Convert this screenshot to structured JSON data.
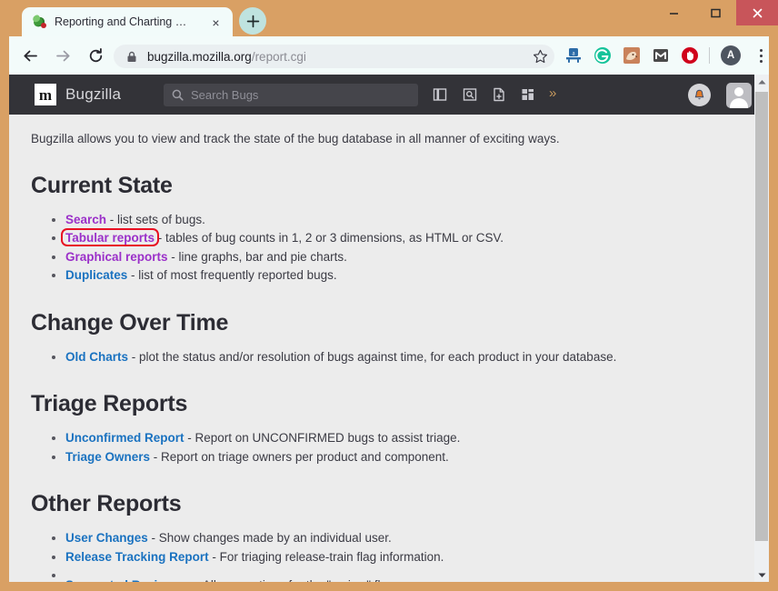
{
  "window": {
    "minimize_label": "Minimize",
    "maximize_label": "Maximize",
    "close_label": "Close",
    "accent_color": "#d9a064",
    "close_button_color": "#c8555a"
  },
  "browser": {
    "tab": {
      "title": "Reporting and Charting Kitchen",
      "favicon": "bugzilla-bug-favicon",
      "close_label": "×"
    },
    "new_tab_label": "+",
    "nav": {
      "back": "back-arrow",
      "forward": "forward-arrow",
      "reload": "reload-arrow"
    },
    "url": {
      "lock": "lock-icon",
      "domain": "bugzilla.mozilla.org",
      "path": "/report.cgi"
    },
    "bookmark_label": "star-outline",
    "extensions": [
      {
        "name": "amazon-assistant-icon",
        "letter": "a",
        "color": "#3a6ea5"
      },
      {
        "name": "grammarly-icon",
        "letter": "G",
        "color": "#15c39a"
      },
      {
        "name": "dog-extension-icon",
        "letter": "",
        "color": "#c9825b"
      },
      {
        "name": "gmail-checker-icon",
        "letter": "M",
        "color": "#4a4a4a"
      },
      {
        "name": "adblock-icon",
        "letter": "",
        "color": "#d0021b"
      }
    ],
    "profile_initial": "A",
    "menu_label": "chrome-menu"
  },
  "bugzilla": {
    "logo_letter": "m",
    "site_title": "Bugzilla",
    "search": {
      "placeholder": "Search Bugs",
      "value": ""
    },
    "nav_icons": [
      "browse-columns-icon",
      "search-bugs-icon",
      "new-bug-icon",
      "dashboard-grid-icon"
    ],
    "more_label": "»",
    "bell_label": "notifications-bell",
    "avatar_label": "user-avatar"
  },
  "page": {
    "intro": "Bugzilla allows you to view and track the state of the bug database in all manner of exciting ways.",
    "sections": [
      {
        "heading": "Current State",
        "items": [
          {
            "link": "Search",
            "color": "violet",
            "desc": " - list sets of bugs."
          },
          {
            "link": "Tabular reports",
            "color": "violet",
            "desc": " - tables of bug counts in 1, 2 or 3 dimensions, as HTML or CSV."
          },
          {
            "link": "Graphical reports",
            "color": "violet",
            "desc": " - line graphs, bar and pie charts."
          },
          {
            "link": "Duplicates",
            "color": "blue",
            "desc": " - list of most frequently reported bugs."
          }
        ]
      },
      {
        "heading": "Change Over Time",
        "items": [
          {
            "link": "Old Charts",
            "color": "blue",
            "desc": " - plot the status and/or resolution of bugs against time, for each product in your database."
          }
        ]
      },
      {
        "heading": "Triage Reports",
        "items": [
          {
            "link": "Unconfirmed Report",
            "color": "blue",
            "desc": " - Report on UNCONFIRMED bugs to assist triage."
          },
          {
            "link": "Triage Owners",
            "color": "blue",
            "desc": " - Report on triage owners per product and component."
          }
        ]
      },
      {
        "heading": "Other Reports",
        "items": [
          {
            "link": "User Changes",
            "color": "blue",
            "desc": " - Show changes made by an individual user."
          },
          {
            "link": "Release Tracking Report",
            "color": "blue",
            "desc": " - For triaging release-train flag information."
          },
          {
            "link": "Suggested Reviewers",
            "color": "blue",
            "desc": " - All suggestions for the \"review\" flag."
          }
        ]
      }
    ]
  },
  "annotation": {
    "target": "Tabular reports",
    "color": "#e81123",
    "shape": "rounded-rectangle"
  },
  "scrollbar": {
    "up_label": "▲",
    "down_label": "▼",
    "thumb_label": "vertical-scroll-thumb"
  }
}
